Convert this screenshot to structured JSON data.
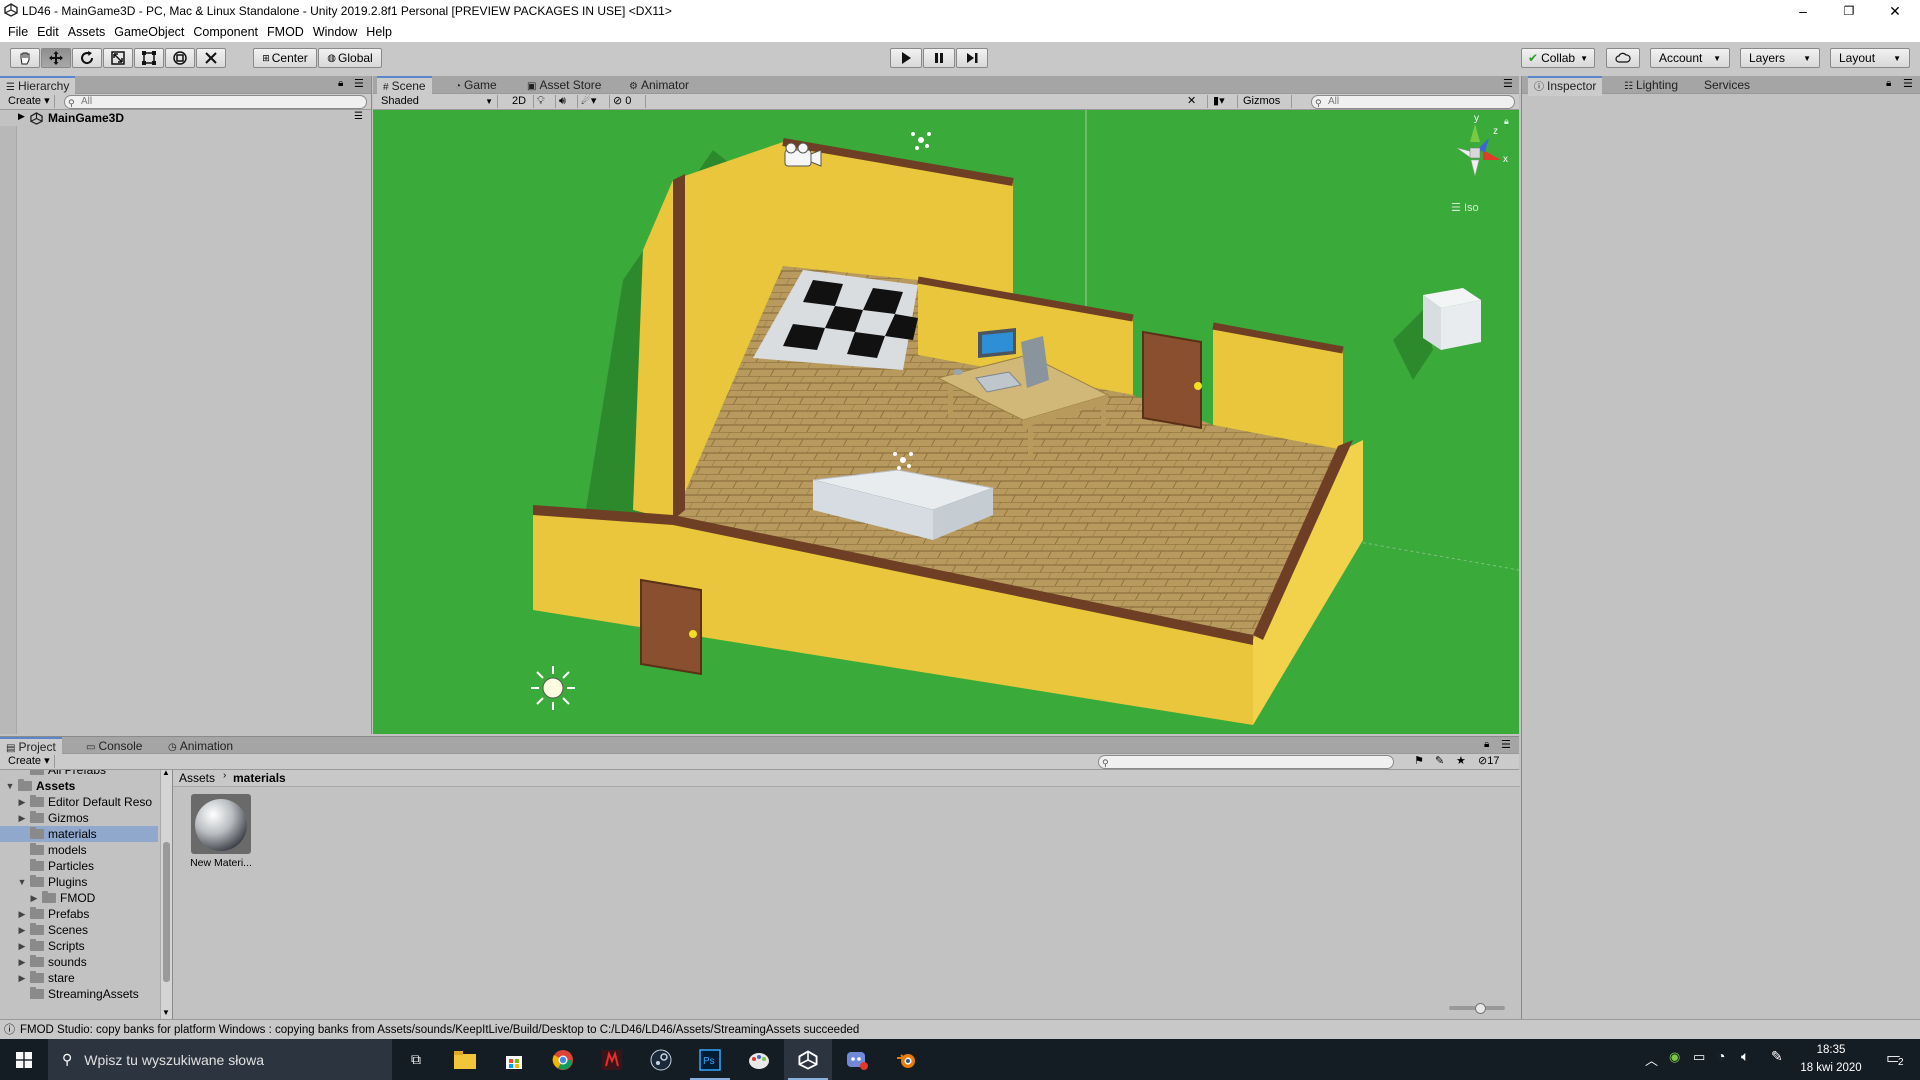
{
  "window": {
    "title": "LD46 - MainGame3D - PC, Mac & Linux Standalone - Unity 2019.2.8f1 Personal [PREVIEW PACKAGES IN USE] <DX11>",
    "controls": {
      "minimize": "–",
      "maximize": "❐",
      "close": "✕"
    }
  },
  "menu": [
    "File",
    "Edit",
    "Assets",
    "GameObject",
    "Component",
    "FMOD",
    "Window",
    "Help"
  ],
  "toolbar": {
    "tools": [
      "hand-tool",
      "move-tool",
      "rotate-tool",
      "scale-tool",
      "rect-tool",
      "transform-tool",
      "custom-tool"
    ],
    "active_tool": "move-tool",
    "pivot": "Center",
    "space": "Global",
    "collab": "Collab",
    "account": "Account",
    "layers": "Layers",
    "layout": "Layout"
  },
  "hierarchy": {
    "tab": "Hierarchy",
    "create": "Create",
    "search_placeholder": "All",
    "scene_name": "MainGame3D"
  },
  "scene_view": {
    "tabs": [
      "Scene",
      "Game",
      "Asset Store",
      "Animator"
    ],
    "active_tab": "Scene",
    "shading": "Shaded",
    "mode_2d": "2D",
    "hidden_count": "0",
    "gizmos": "Gizmos",
    "search_placeholder": "All",
    "projection": "Iso",
    "axes": {
      "x": "x",
      "y": "y",
      "z": "z"
    }
  },
  "inspector": {
    "tabs": [
      "Inspector",
      "Lighting",
      "Services"
    ],
    "active_tab": "Inspector"
  },
  "project": {
    "tabs": [
      "Project",
      "Console",
      "Animation"
    ],
    "active_tab": "Project",
    "create": "Create",
    "breadcrumb": [
      "Assets",
      "materials"
    ],
    "hidden_count": "17",
    "tree": [
      {
        "label": "All Prefabs",
        "depth": 1,
        "fold": ""
      },
      {
        "label": "Assets",
        "depth": 0,
        "fold": "open",
        "bold": true
      },
      {
        "label": "Editor Default Reso",
        "depth": 1,
        "fold": "closed"
      },
      {
        "label": "Gizmos",
        "depth": 1,
        "fold": "closed"
      },
      {
        "label": "materials",
        "depth": 1,
        "fold": "",
        "selected": true
      },
      {
        "label": "models",
        "depth": 1,
        "fold": ""
      },
      {
        "label": "Particles",
        "depth": 1,
        "fold": ""
      },
      {
        "label": "Plugins",
        "depth": 1,
        "fold": "open"
      },
      {
        "label": "FMOD",
        "depth": 2,
        "fold": "closed"
      },
      {
        "label": "Prefabs",
        "depth": 1,
        "fold": "closed"
      },
      {
        "label": "Scenes",
        "depth": 1,
        "fold": "closed"
      },
      {
        "label": "Scripts",
        "depth": 1,
        "fold": "closed"
      },
      {
        "label": "sounds",
        "depth": 1,
        "fold": "closed"
      },
      {
        "label": "stare",
        "depth": 1,
        "fold": "closed"
      },
      {
        "label": "StreamingAssets",
        "depth": 1,
        "fold": ""
      }
    ],
    "assets": [
      {
        "label": "New Materi..."
      }
    ]
  },
  "status": {
    "message": "FMOD Studio: copy banks for platform Windows : copying banks from Assets/sounds/KeepItLive/Build/Desktop to C:/LD46/LD46/Assets/StreamingAssets succeeded"
  },
  "taskbar": {
    "search_placeholder": "Wpisz tu wyszukiwane słowa",
    "time": "18:35",
    "date": "18 kwi 2020",
    "notifications": "2",
    "apps": [
      "task-view",
      "file-explorer",
      "store",
      "chrome",
      "msi-dragon",
      "steam",
      "photoshop",
      "paint",
      "unity",
      "discord",
      "blender"
    ]
  },
  "colors": {
    "scene_bg": "#3aaa3a",
    "wall": "#e9c63b",
    "trim": "#6e3f24",
    "floor": "#b99a5e",
    "accent": "#5b86c9"
  }
}
